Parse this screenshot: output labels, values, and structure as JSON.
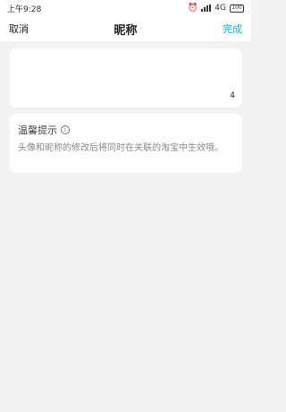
{
  "status_bar": {
    "time": "上午9:28",
    "network": "4G",
    "battery": "100"
  },
  "header": {
    "cancel_label": "取消",
    "title": "昵称",
    "done_label": "完成"
  },
  "nickname_input": {
    "value": "",
    "char_count": "4"
  },
  "tip": {
    "title": "温馨提示",
    "body": "头像和昵称的修改后将同时在关联的淘宝中生效哦。"
  },
  "icons": {
    "alarm": "alarm-icon",
    "signal": "signal-icon",
    "battery": "battery-icon",
    "info": "info-icon"
  }
}
